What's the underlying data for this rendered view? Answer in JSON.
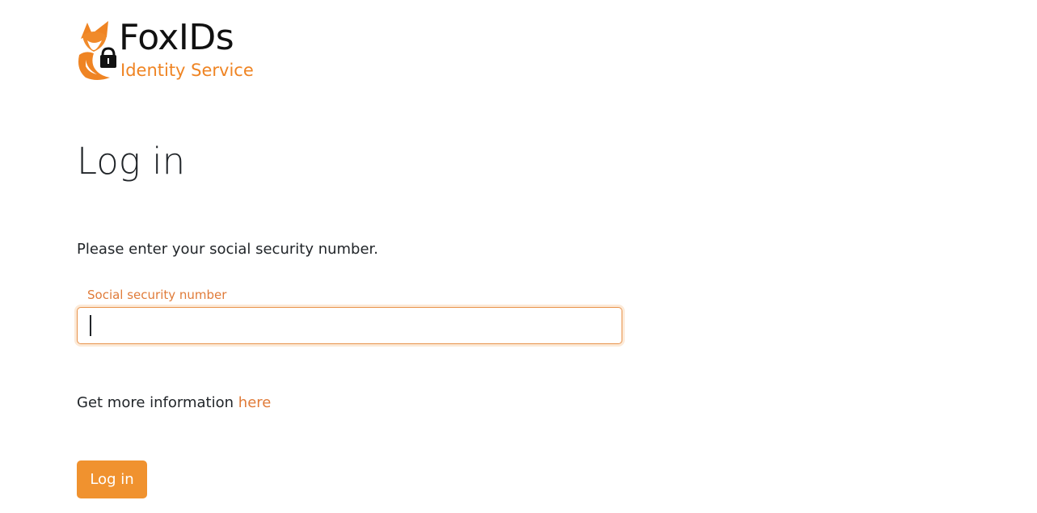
{
  "brand": {
    "name": "FoxIDs",
    "tagline": "Identity Service",
    "logo_icon": "fox-lock-icon",
    "accent_color": "#ef8423"
  },
  "page": {
    "title": "Log in",
    "instructions": "Please enter your social security number."
  },
  "form": {
    "ssn_label": "Social security number",
    "ssn_value": "",
    "ssn_placeholder": ""
  },
  "info": {
    "text": "Get more information",
    "link_label": "here"
  },
  "actions": {
    "login_label": "Log in",
    "button_color": "#f0922f"
  }
}
